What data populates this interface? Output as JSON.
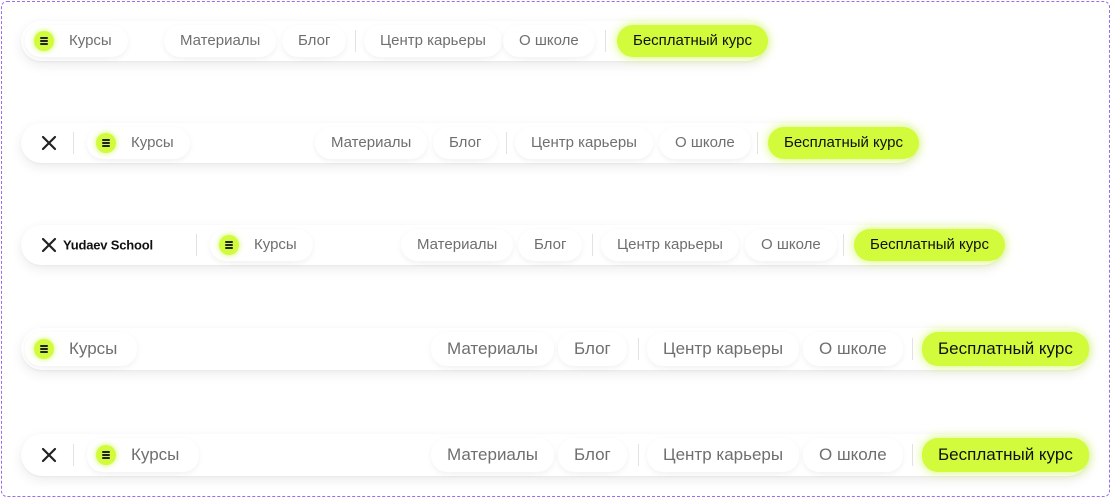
{
  "logo_text": "Yudaev School",
  "nav": {
    "courses": "Курсы",
    "materials": "Материалы",
    "blog": "Блог",
    "career": "Центр карьеры",
    "about": "О школе",
    "cta": "Бесплатный курс"
  },
  "colors": {
    "accent": "#d2fb3c",
    "frame": "#9b6bf0",
    "text_muted": "#6f6f6f"
  },
  "icons": [
    "menu-icon",
    "logo-x-icon"
  ]
}
